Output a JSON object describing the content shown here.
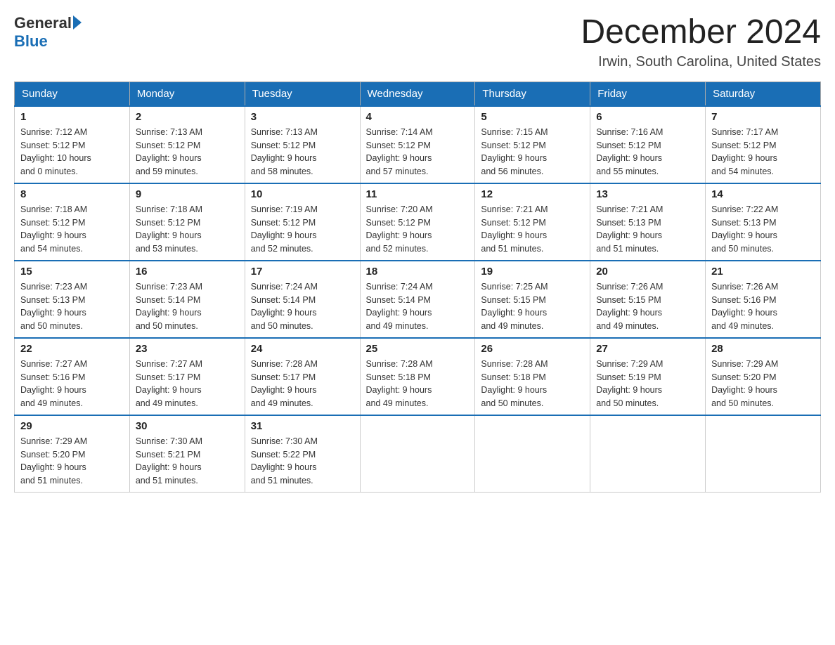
{
  "header": {
    "logo_general": "General",
    "logo_blue": "Blue",
    "month_title": "December 2024",
    "location": "Irwin, South Carolina, United States"
  },
  "days_of_week": [
    "Sunday",
    "Monday",
    "Tuesday",
    "Wednesday",
    "Thursday",
    "Friday",
    "Saturday"
  ],
  "weeks": [
    [
      {
        "day": "1",
        "sunrise": "7:12 AM",
        "sunset": "5:12 PM",
        "daylight_hours": "10",
        "daylight_minutes": "0"
      },
      {
        "day": "2",
        "sunrise": "7:13 AM",
        "sunset": "5:12 PM",
        "daylight_hours": "9",
        "daylight_minutes": "59"
      },
      {
        "day": "3",
        "sunrise": "7:13 AM",
        "sunset": "5:12 PM",
        "daylight_hours": "9",
        "daylight_minutes": "58"
      },
      {
        "day": "4",
        "sunrise": "7:14 AM",
        "sunset": "5:12 PM",
        "daylight_hours": "9",
        "daylight_minutes": "57"
      },
      {
        "day": "5",
        "sunrise": "7:15 AM",
        "sunset": "5:12 PM",
        "daylight_hours": "9",
        "daylight_minutes": "56"
      },
      {
        "day": "6",
        "sunrise": "7:16 AM",
        "sunset": "5:12 PM",
        "daylight_hours": "9",
        "daylight_minutes": "55"
      },
      {
        "day": "7",
        "sunrise": "7:17 AM",
        "sunset": "5:12 PM",
        "daylight_hours": "9",
        "daylight_minutes": "54"
      }
    ],
    [
      {
        "day": "8",
        "sunrise": "7:18 AM",
        "sunset": "5:12 PM",
        "daylight_hours": "9",
        "daylight_minutes": "54"
      },
      {
        "day": "9",
        "sunrise": "7:18 AM",
        "sunset": "5:12 PM",
        "daylight_hours": "9",
        "daylight_minutes": "53"
      },
      {
        "day": "10",
        "sunrise": "7:19 AM",
        "sunset": "5:12 PM",
        "daylight_hours": "9",
        "daylight_minutes": "52"
      },
      {
        "day": "11",
        "sunrise": "7:20 AM",
        "sunset": "5:12 PM",
        "daylight_hours": "9",
        "daylight_minutes": "52"
      },
      {
        "day": "12",
        "sunrise": "7:21 AM",
        "sunset": "5:12 PM",
        "daylight_hours": "9",
        "daylight_minutes": "51"
      },
      {
        "day": "13",
        "sunrise": "7:21 AM",
        "sunset": "5:13 PM",
        "daylight_hours": "9",
        "daylight_minutes": "51"
      },
      {
        "day": "14",
        "sunrise": "7:22 AM",
        "sunset": "5:13 PM",
        "daylight_hours": "9",
        "daylight_minutes": "50"
      }
    ],
    [
      {
        "day": "15",
        "sunrise": "7:23 AM",
        "sunset": "5:13 PM",
        "daylight_hours": "9",
        "daylight_minutes": "50"
      },
      {
        "day": "16",
        "sunrise": "7:23 AM",
        "sunset": "5:14 PM",
        "daylight_hours": "9",
        "daylight_minutes": "50"
      },
      {
        "day": "17",
        "sunrise": "7:24 AM",
        "sunset": "5:14 PM",
        "daylight_hours": "9",
        "daylight_minutes": "50"
      },
      {
        "day": "18",
        "sunrise": "7:24 AM",
        "sunset": "5:14 PM",
        "daylight_hours": "9",
        "daylight_minutes": "49"
      },
      {
        "day": "19",
        "sunrise": "7:25 AM",
        "sunset": "5:15 PM",
        "daylight_hours": "9",
        "daylight_minutes": "49"
      },
      {
        "day": "20",
        "sunrise": "7:26 AM",
        "sunset": "5:15 PM",
        "daylight_hours": "9",
        "daylight_minutes": "49"
      },
      {
        "day": "21",
        "sunrise": "7:26 AM",
        "sunset": "5:16 PM",
        "daylight_hours": "9",
        "daylight_minutes": "49"
      }
    ],
    [
      {
        "day": "22",
        "sunrise": "7:27 AM",
        "sunset": "5:16 PM",
        "daylight_hours": "9",
        "daylight_minutes": "49"
      },
      {
        "day": "23",
        "sunrise": "7:27 AM",
        "sunset": "5:17 PM",
        "daylight_hours": "9",
        "daylight_minutes": "49"
      },
      {
        "day": "24",
        "sunrise": "7:28 AM",
        "sunset": "5:17 PM",
        "daylight_hours": "9",
        "daylight_minutes": "49"
      },
      {
        "day": "25",
        "sunrise": "7:28 AM",
        "sunset": "5:18 PM",
        "daylight_hours": "9",
        "daylight_minutes": "49"
      },
      {
        "day": "26",
        "sunrise": "7:28 AM",
        "sunset": "5:18 PM",
        "daylight_hours": "9",
        "daylight_minutes": "50"
      },
      {
        "day": "27",
        "sunrise": "7:29 AM",
        "sunset": "5:19 PM",
        "daylight_hours": "9",
        "daylight_minutes": "50"
      },
      {
        "day": "28",
        "sunrise": "7:29 AM",
        "sunset": "5:20 PM",
        "daylight_hours": "9",
        "daylight_minutes": "50"
      }
    ],
    [
      {
        "day": "29",
        "sunrise": "7:29 AM",
        "sunset": "5:20 PM",
        "daylight_hours": "9",
        "daylight_minutes": "51"
      },
      {
        "day": "30",
        "sunrise": "7:30 AM",
        "sunset": "5:21 PM",
        "daylight_hours": "9",
        "daylight_minutes": "51"
      },
      {
        "day": "31",
        "sunrise": "7:30 AM",
        "sunset": "5:22 PM",
        "daylight_hours": "9",
        "daylight_minutes": "51"
      },
      null,
      null,
      null,
      null
    ]
  ],
  "labels": {
    "sunrise": "Sunrise:",
    "sunset": "Sunset:",
    "daylight": "Daylight:",
    "hours_suffix": "hours",
    "and": "and",
    "minutes_suffix": "minutes."
  }
}
